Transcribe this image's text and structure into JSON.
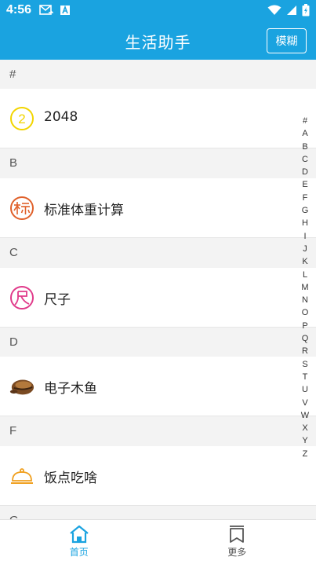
{
  "status_bar": {
    "time": "4:56"
  },
  "app_bar": {
    "title": "生活助手",
    "blur_button": "模糊"
  },
  "sections": [
    {
      "letter": "#",
      "item": {
        "label": "2048",
        "icon": "number-2-icon",
        "color": "#f2d500"
      }
    },
    {
      "letter": "B",
      "item": {
        "label": "标准体重计算",
        "icon": "biao-char-icon",
        "color": "#e0602a"
      }
    },
    {
      "letter": "C",
      "item": {
        "label": "尺子",
        "icon": "chi-char-icon",
        "color": "#e03a8a"
      }
    },
    {
      "letter": "D",
      "item": {
        "label": "电子木鱼",
        "icon": "wooden-fish-icon",
        "color": "#8a5a2b"
      }
    },
    {
      "letter": "F",
      "item": {
        "label": "饭点吃啥",
        "icon": "food-cloche-icon",
        "color": "#f0a020"
      }
    },
    {
      "letter": "G"
    }
  ],
  "alpha_index": [
    "#",
    "A",
    "B",
    "C",
    "D",
    "E",
    "F",
    "G",
    "H",
    "I",
    "J",
    "K",
    "L",
    "M",
    "N",
    "O",
    "P",
    "Q",
    "R",
    "S",
    "T",
    "U",
    "V",
    "W",
    "X",
    "Y",
    "Z"
  ],
  "bottom_nav": {
    "home": {
      "label": "首页",
      "icon": "home-icon"
    },
    "more": {
      "label": "更多",
      "icon": "bookmark-icon"
    }
  },
  "colors": {
    "accent": "#1aa3e0"
  }
}
